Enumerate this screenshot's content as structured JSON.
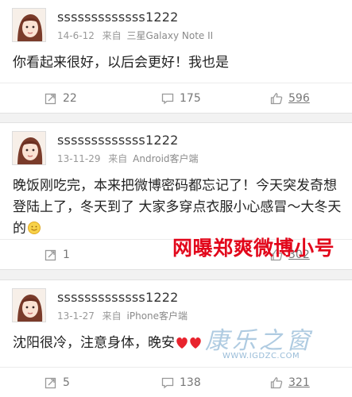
{
  "posts": [
    {
      "username": "sssssssssssss1222",
      "date": "14-6-12",
      "source_prefix": "来自",
      "device": "三星Galaxy Note II",
      "content": "你看起来很好，以后会更好！我也是",
      "repost_count": "22",
      "comment_count": "175",
      "like_count": "596"
    },
    {
      "username": "sssssssssssss1222",
      "date": "13-11-29",
      "source_prefix": "来自",
      "device": "Android客户端",
      "content": "晚饭刚吃完，本来把微博密码都忘记了！今天突发奇想登陆上了，冬天到了 大家多穿点衣服小心感冒～大冬天的",
      "emoji": "sun-emoji",
      "repost_count": "1",
      "comment_count": "",
      "like_count": "302"
    },
    {
      "username": "sssssssssssss1222",
      "date": "13-1-27",
      "source_prefix": "来自",
      "device": "iPhone客户端",
      "content": "沈阳很冷，注意身体，晚安",
      "emoji": "heart-emoji",
      "repost_count": "5",
      "comment_count": "138",
      "like_count": "321"
    }
  ],
  "overlay": {
    "title": "网曝郑爽微博小号"
  },
  "watermark": {
    "script": "康乐之窗",
    "url": "WWW.IGDZC.COM"
  },
  "colors": {
    "background": "#f2f2f2",
    "card": "#ffffff",
    "overlay_red": "#e2071b",
    "meta_gray": "#999999"
  },
  "icons": {
    "repost": "repost-icon",
    "comment": "comment-icon",
    "like": "thumbs-up-icon"
  }
}
